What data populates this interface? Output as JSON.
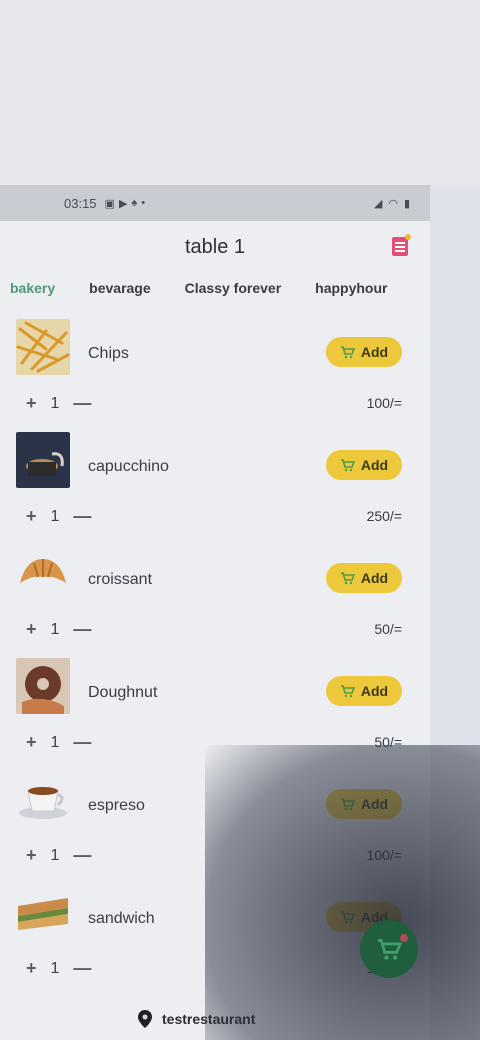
{
  "status_bar": {
    "time": "03:15",
    "dot": "•"
  },
  "appbar": {
    "title": "table 1",
    "order_icon": "receipt-icon",
    "accent": "#e2507a"
  },
  "tabs": [
    {
      "label": "bakery",
      "active": true
    },
    {
      "label": "bevarage",
      "active": false
    },
    {
      "label": "Classy forever",
      "active": false
    },
    {
      "label": "happyhour",
      "active": false
    }
  ],
  "items": [
    {
      "name": "Chips",
      "qty": "1",
      "price": "100/=",
      "add_label": "Add",
      "plus": "+",
      "minus": "—"
    },
    {
      "name": "capucchino",
      "qty": "1",
      "price": "250/=",
      "add_label": "Add",
      "plus": "+",
      "minus": "—"
    },
    {
      "name": "croissant",
      "qty": "1",
      "price": "50/=",
      "add_label": "Add",
      "plus": "+",
      "minus": "—"
    },
    {
      "name": "Doughnut",
      "qty": "1",
      "price": "50/=",
      "add_label": "Add",
      "plus": "+",
      "minus": "—"
    },
    {
      "name": "espreso",
      "qty": "1",
      "price": "100/=",
      "add_label": "Add",
      "plus": "+",
      "minus": "—"
    },
    {
      "name": "sandwich",
      "qty": "1",
      "price": "100/=",
      "add_label": "Add",
      "plus": "+",
      "minus": "—"
    }
  ],
  "fab": {
    "icon": "cart-icon",
    "color": "#1f5f3e"
  },
  "footer": {
    "restaurant": "testrestaurant",
    "icon": "location-pin-icon"
  },
  "colors": {
    "add_button": "#ecc83a",
    "active_tab": "#4f9a78"
  }
}
